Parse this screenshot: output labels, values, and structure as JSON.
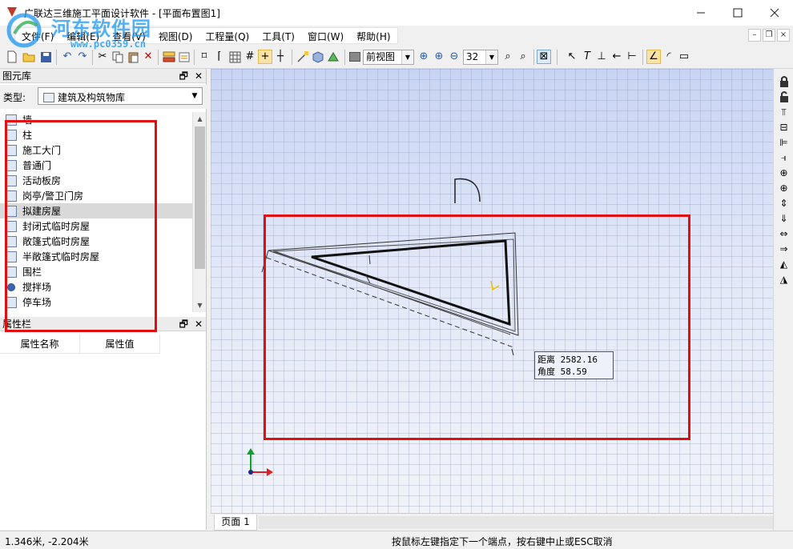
{
  "window": {
    "title": "广联达三维施工平面设计软件 - [平面布置图1]",
    "minimize_icon": "minimize-icon",
    "maximize_icon": "maximize-icon",
    "close_icon": "close-icon"
  },
  "watermark": {
    "text": "河东软件园",
    "url": "www.pc0359.cn"
  },
  "menu": [
    {
      "label": "文件(F)"
    },
    {
      "label": "编辑(E)"
    },
    {
      "label": "查看(V)"
    },
    {
      "label": "视图(D)"
    },
    {
      "label": "工程量(Q)"
    },
    {
      "label": "工具(T)"
    },
    {
      "label": "窗口(W)"
    },
    {
      "label": "帮助(H)"
    }
  ],
  "toolbar": {
    "view_select": "前视图",
    "zoom_value": "32"
  },
  "library_panel": {
    "title": "图元库",
    "type_label": "类型:",
    "type_value": "建筑及构筑物库",
    "items": [
      {
        "label": "墙"
      },
      {
        "label": "柱"
      },
      {
        "label": "施工大门"
      },
      {
        "label": "普通门"
      },
      {
        "label": "活动板房"
      },
      {
        "label": "岗亭/警卫门房"
      },
      {
        "label": "拟建房屋",
        "selected": true
      },
      {
        "label": "封闭式临时房屋"
      },
      {
        "label": "敞篷式临时房屋"
      },
      {
        "label": "半敞篷式临时房屋"
      },
      {
        "label": "围栏"
      },
      {
        "label": "搅拌场"
      },
      {
        "label": "停车场"
      }
    ]
  },
  "property_panel": {
    "title": "属性栏",
    "col_name": "属性名称",
    "col_value": "属性值"
  },
  "canvas": {
    "tooltip_distance": "距离 2582.16",
    "tooltip_angle": "角度 58.59"
  },
  "page_tab": "页面 1",
  "status": {
    "coords": "1.346米, -2.204米",
    "message": "按鼠标左键指定下一个端点，按右键中止或ESC取消"
  },
  "colors": {
    "highlight_box": "#e01010",
    "axis_x": "#e02020",
    "axis_y": "#10a030",
    "cursor": "#f0c000"
  }
}
